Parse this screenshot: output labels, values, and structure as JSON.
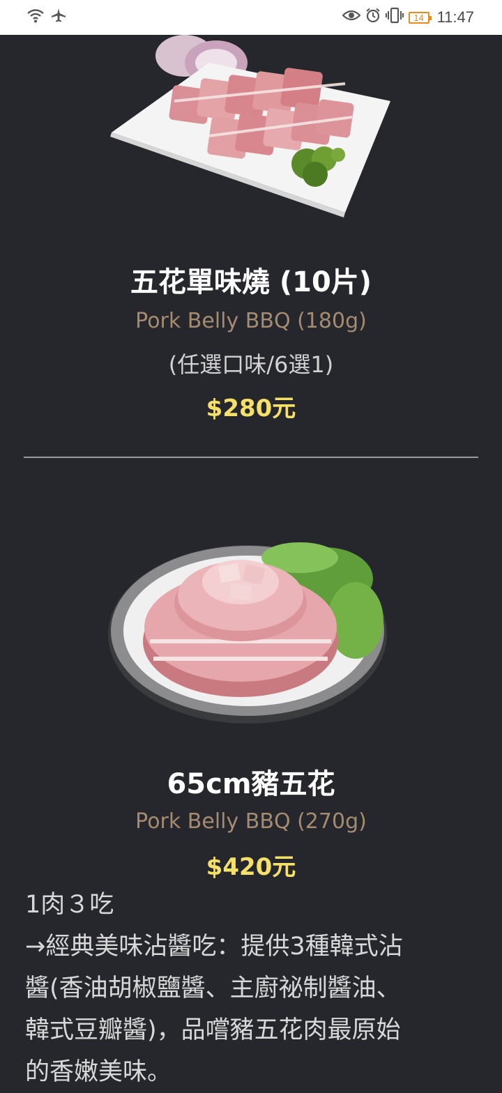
{
  "status_bar": {
    "time": "11:47",
    "battery": "14",
    "left_icons": [
      "wifi-icon",
      "airplane-icon"
    ],
    "right_icons": [
      "eye-icon",
      "alarm-icon",
      "vibrate-icon",
      "battery-icon"
    ]
  },
  "items": [
    {
      "title": "五花單味燒 (10片)",
      "subtitle_en": "Pork Belly BBQ (180g)",
      "note": "(任選口味/6選1)",
      "price": "$280元"
    },
    {
      "title": "65cm豬五花",
      "subtitle_en": "Pork Belly BBQ (270g)",
      "price": "$420元",
      "description": [
        "1肉３吃",
        "→經典美味沾醬吃：提供3種韓式沾",
        "醬(香油胡椒鹽醬、主廚祕制醬油、",
        "韓式豆瓣醬)，品嚐豬五花肉最原始",
        "的香嫩美味。"
      ]
    }
  ]
}
